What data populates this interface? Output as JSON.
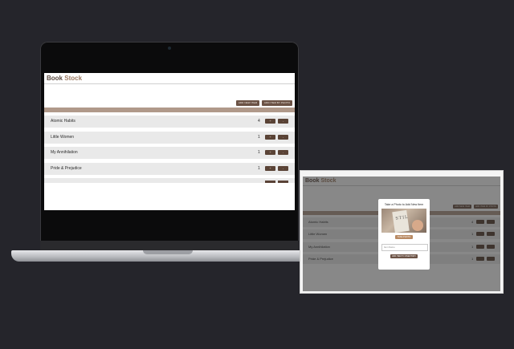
{
  "app": {
    "title_part1": "Book",
    "title_part2": "Stock",
    "accent_color": "#9c7a62",
    "button_color": "#6b5245"
  },
  "toolbar": {
    "add_item_label": "ADD NEW ITEM",
    "add_by_photo_label": "ADD ITEM BY PHOTO"
  },
  "books": [
    {
      "name": "Atomic Habits",
      "qty": "4"
    },
    {
      "name": "Little Women",
      "qty": "1"
    },
    {
      "name": "My Annihilation",
      "qty": "1"
    },
    {
      "name": "Pride & Prejudice",
      "qty": "1"
    }
  ],
  "row_buttons": {
    "plus": "+",
    "minus": "-"
  },
  "modal": {
    "title": "Take a Photo to Add New Item",
    "snap_label": "TAKE PHOTO",
    "input_placeholder": "Item Name",
    "add_label": "ADD ITEM TO INVENTORY"
  }
}
